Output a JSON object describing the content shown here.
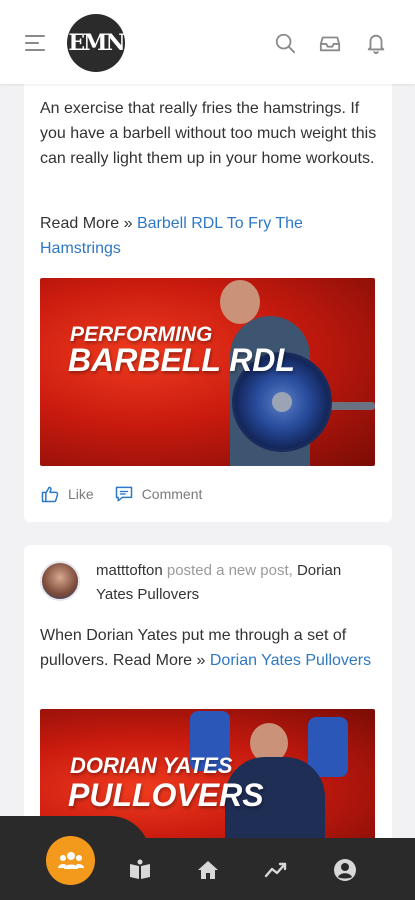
{
  "header": {
    "logo_text": "EMN",
    "icons": [
      "menu-icon",
      "search-icon",
      "inbox-icon",
      "bell-icon"
    ]
  },
  "post1": {
    "body": "An exercise that really fries the hamstrings. If you have a barbell without too much weight this can really light them up in your home workouts.",
    "read_more_prefix": "Read More » ",
    "read_more_link": "Barbell RDL To Fry The Hamstrings",
    "banner_line1": "PERFORMING",
    "banner_line2": "BARBELL RDL",
    "like_label": "Like",
    "comment_label": "Comment"
  },
  "post2": {
    "author": "matttofton",
    "action": " posted a new post, ",
    "post_title": "Dorian Yates Pullovers",
    "body": "When Dorian Yates put me through a set of pullovers. Read More » ",
    "body_link": "Dorian Yates Pullovers",
    "banner_line1": "DORIAN YATES",
    "banner_line2": "PULLOVERS"
  },
  "bottom_nav": {
    "items": [
      "groups-icon",
      "book-icon",
      "home-icon",
      "activity-icon",
      "profile-icon"
    ]
  },
  "colors": {
    "accent": "#f39a1d",
    "link": "#2f78c4",
    "nav_bg": "#2a2a2a",
    "banner_red": "#c81a0e"
  }
}
